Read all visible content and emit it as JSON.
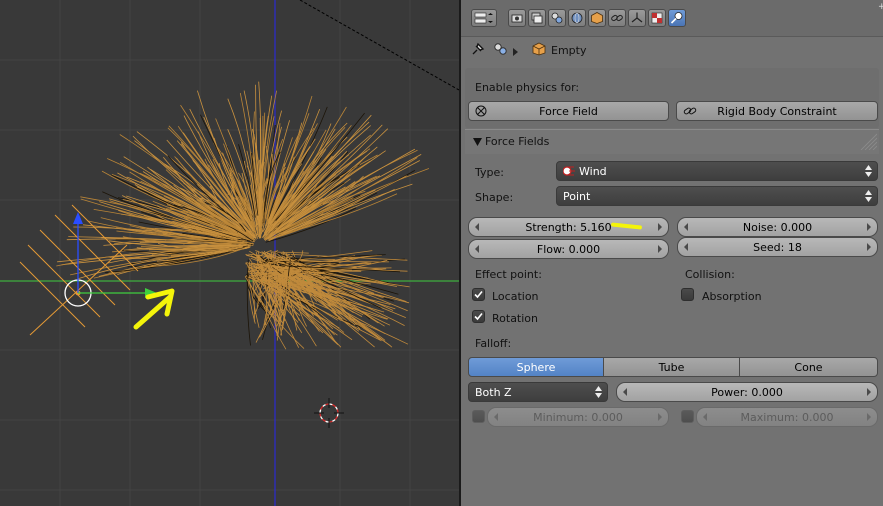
{
  "colors": {
    "viewport_bg": "#393939",
    "panel_bg": "#727272",
    "accent_blue": "#5680c2",
    "hair": "#c8913f",
    "annotation": "#f4f40a"
  },
  "header": {
    "context_icons": [
      "render-icon",
      "render-layers-icon",
      "scene-icon",
      "world-icon",
      "object-icon",
      "constraints-icon",
      "modifiers-icon",
      "texture-icon",
      "physics-icon"
    ],
    "active_context": "physics-icon"
  },
  "breadcrumb": {
    "object_name": "Empty"
  },
  "enable_physics": {
    "label": "Enable physics for:",
    "force_field": "Force Field",
    "rigid_body_constraint": "Rigid Body Constraint"
  },
  "force_fields": {
    "panel_title": "Force Fields",
    "type_label": "Type:",
    "type_value": "Wind",
    "shape_label": "Shape:",
    "shape_value": "Point",
    "strength": "Strength: 5.160",
    "noise": "Noise: 0.000",
    "flow": "Flow: 0.000",
    "seed": "Seed: 18",
    "effect_point_label": "Effect point:",
    "location": "Location",
    "rotation": "Rotation",
    "collision_label": "Collision:",
    "absorption": "Absorption",
    "location_checked": true,
    "rotation_checked": true,
    "absorption_checked": false
  },
  "falloff": {
    "label": "Falloff:",
    "tabs": [
      "Sphere",
      "Tube",
      "Cone"
    ],
    "active_tab": "Sphere",
    "direction": "Both Z",
    "power": "Power: 0.000",
    "minimum": "Minimum: 0.000",
    "maximum": "Maximum: 0.000"
  }
}
